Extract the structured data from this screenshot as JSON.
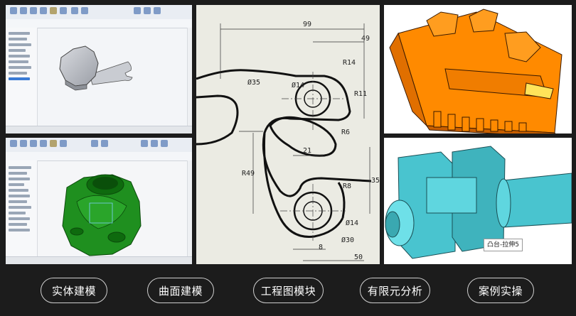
{
  "buttons": [
    {
      "label": "实体建模"
    },
    {
      "label": "曲面建模"
    },
    {
      "label": "工程图模块"
    },
    {
      "label": "有限元分析"
    },
    {
      "label": "案例实操"
    }
  ],
  "drawing": {
    "dims": [
      "99",
      "49",
      "Ø35",
      "Ø14",
      "R14",
      "R11",
      "21",
      "R6",
      "35",
      "R49",
      "R8",
      "Ø14",
      "Ø30",
      "8",
      "50"
    ]
  },
  "cad_label": "凸台-拉伸5",
  "colors": {
    "background": "#1c1c1c",
    "green_part": "#1f8f1f",
    "orange_part": "#ff8a00",
    "teal_part": "#49c4cf"
  }
}
